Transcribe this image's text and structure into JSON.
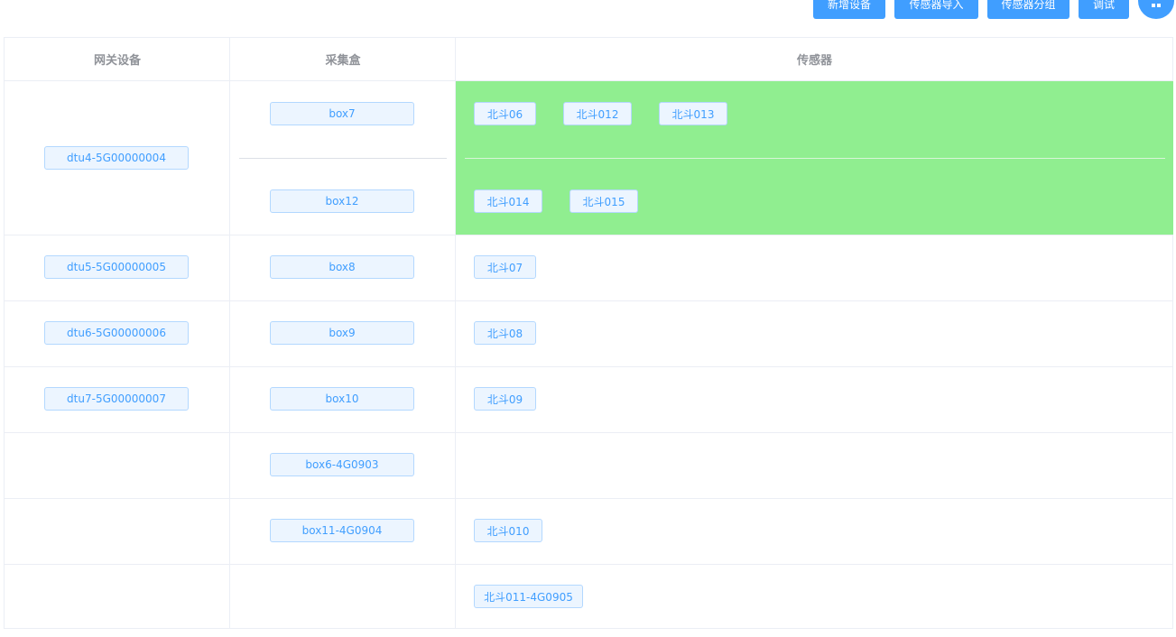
{
  "toolbar": {
    "buttons": [
      "新增设备",
      "传感器导入",
      "传感器分组",
      "调试"
    ],
    "more_icon": "grid-icon"
  },
  "table": {
    "headers": [
      "网关设备",
      "采集盒",
      "传感器"
    ],
    "rows": [
      {
        "gateway": "dtu4-5G00000004",
        "boxes": [
          {
            "name": "box7",
            "sensors": [
              "北斗06",
              "北斗012",
              "北斗013"
            ]
          },
          {
            "name": "box12",
            "sensors": [
              "北斗014",
              "北斗015"
            ]
          }
        ],
        "highlight_color": "#90ee90"
      },
      {
        "gateway": "dtu5-5G00000005",
        "boxes": [
          {
            "name": "box8",
            "sensors": [
              "北斗07"
            ]
          }
        ]
      },
      {
        "gateway": "dtu6-5G00000006",
        "boxes": [
          {
            "name": "box9",
            "sensors": [
              "北斗08"
            ]
          }
        ]
      },
      {
        "gateway": "dtu7-5G00000007",
        "boxes": [
          {
            "name": "box10",
            "sensors": [
              "北斗09"
            ]
          }
        ]
      },
      {
        "gateway": "",
        "boxes": [
          {
            "name": "box6-4G0903",
            "sensors": []
          }
        ]
      },
      {
        "gateway": "",
        "boxes": [
          {
            "name": "box11-4G0904",
            "sensors": [
              "北斗010"
            ]
          }
        ]
      },
      {
        "gateway": "",
        "boxes": [
          {
            "name": "",
            "sensors": [
              "北斗011-4G0905"
            ]
          }
        ]
      }
    ]
  },
  "colors": {
    "primary": "#409eff",
    "tag_bg": "#ecf5ff",
    "tag_border": "#b3d8ff",
    "border": "#ebeef5",
    "header_text": "#909399"
  }
}
